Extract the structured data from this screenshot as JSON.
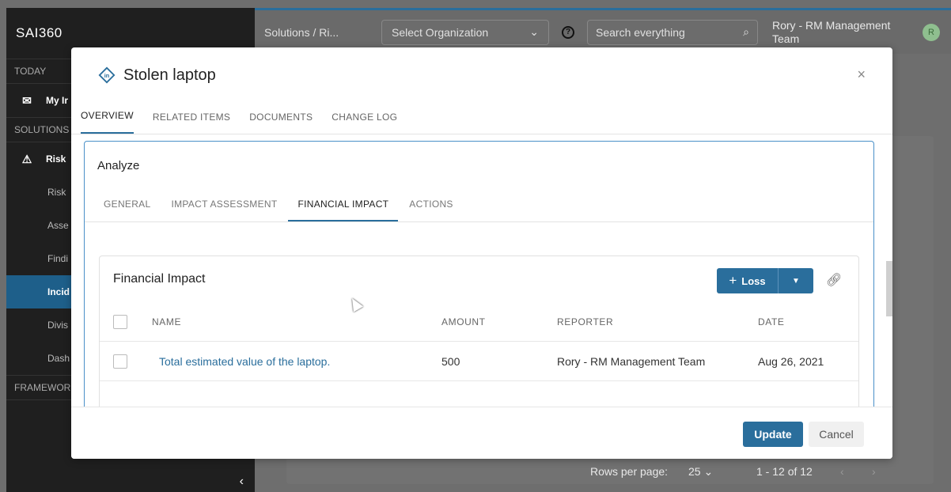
{
  "app": {
    "logo_text": "SAI360",
    "sidebar": {
      "today_label": "TODAY",
      "my_item": "My Ir",
      "solutions_label": "SOLUTIONS",
      "risk_item": "Risk",
      "sub_items": [
        "Risk",
        "Asse",
        "Findi",
        "Incid",
        "Divis",
        "Dash"
      ],
      "active_sub_item": "Incid",
      "frameworks_label": "FRAMEWOR",
      "collapse_glyph": "‹"
    },
    "topbar": {
      "breadcrumb": "Solutions / Ri...",
      "org_placeholder": "Select Organization",
      "help_glyph": "?",
      "search_placeholder": "Search everything",
      "user_name": "Rory - RM Management Team",
      "avatar_initial": "R"
    },
    "footer": {
      "rows_per_page_label": "Rows per page:",
      "rows_per_page_value": "25",
      "page_range": "1 - 12 of 12",
      "prev_glyph": "‹",
      "next_glyph": "›"
    }
  },
  "modal": {
    "title": "Stolen laptop",
    "close_glyph": "×",
    "tabs": [
      {
        "label": "OVERVIEW",
        "active": true
      },
      {
        "label": "RELATED ITEMS",
        "active": false
      },
      {
        "label": "DOCUMENTS",
        "active": false
      },
      {
        "label": "CHANGE LOG",
        "active": false
      }
    ],
    "analyze": {
      "title": "Analyze",
      "tabs": [
        {
          "label": "GENERAL",
          "active": false
        },
        {
          "label": "IMPACT ASSESSMENT",
          "active": false
        },
        {
          "label": "FINANCIAL IMPACT",
          "active": true
        },
        {
          "label": "ACTIONS",
          "active": false
        }
      ],
      "financial_impact": {
        "title": "Financial Impact",
        "add_loss_label": "Loss",
        "columns": [
          "NAME",
          "AMOUNT",
          "REPORTER",
          "DATE"
        ],
        "rows": [
          {
            "name": "Total estimated value of the laptop.",
            "amount": "500",
            "reporter": "Rory - RM Management Team",
            "date": "Aug 26, 2021"
          }
        ]
      }
    },
    "buttons": {
      "update": "Update",
      "cancel": "Cancel"
    }
  },
  "colors": {
    "accent": "#2a6e9c",
    "sidebar_bg": "#1f1f1f",
    "active_item_bg": "#1e5f8a"
  }
}
